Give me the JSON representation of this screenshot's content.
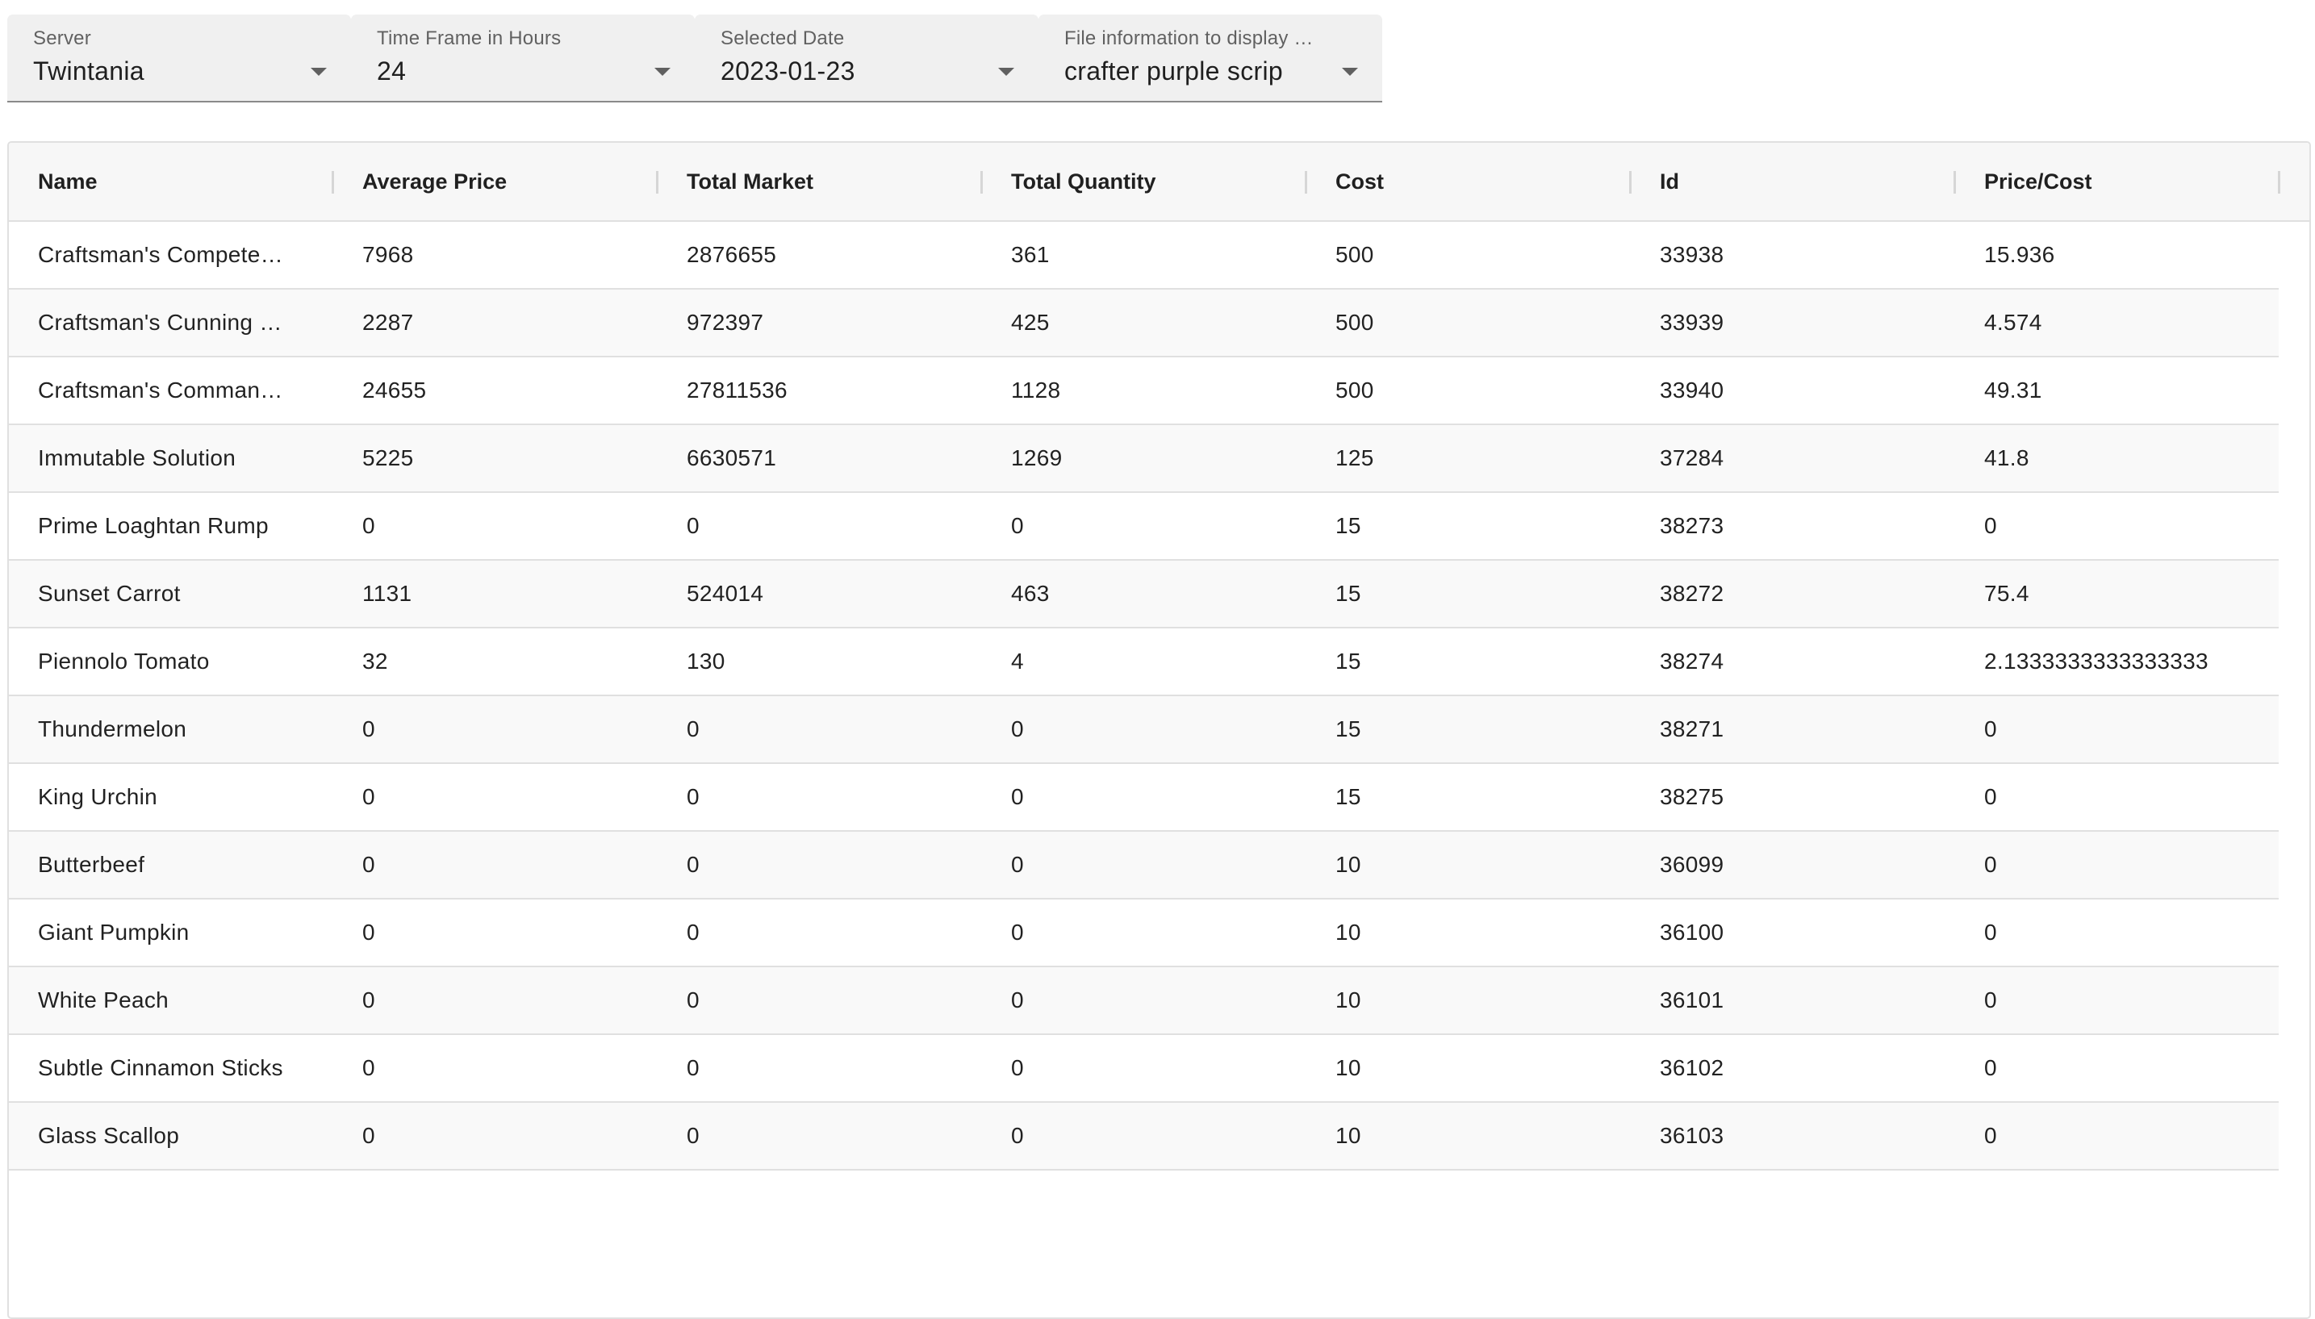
{
  "filters": [
    {
      "label": "Server",
      "value": "Twintania"
    },
    {
      "label": "Time Frame in Hours",
      "value": "24"
    },
    {
      "label": "Selected Date",
      "value": "2023-01-23"
    },
    {
      "label": "File information to display …",
      "value": "crafter purple scrip"
    }
  ],
  "table": {
    "columns": [
      "Name",
      "Average Price",
      "Total Market",
      "Total Quantity",
      "Cost",
      "Id",
      "Price/Cost"
    ],
    "rows": [
      [
        "Craftsman's Compete…",
        "7968",
        "2876655",
        "361",
        "500",
        "33938",
        "15.936"
      ],
      [
        "Craftsman's Cunning …",
        "2287",
        "972397",
        "425",
        "500",
        "33939",
        "4.574"
      ],
      [
        "Craftsman's Comman…",
        "24655",
        "27811536",
        "1128",
        "500",
        "33940",
        "49.31"
      ],
      [
        "Immutable Solution",
        "5225",
        "6630571",
        "1269",
        "125",
        "37284",
        "41.8"
      ],
      [
        "Prime Loaghtan Rump",
        "0",
        "0",
        "0",
        "15",
        "38273",
        "0"
      ],
      [
        "Sunset Carrot",
        "1131",
        "524014",
        "463",
        "15",
        "38272",
        "75.4"
      ],
      [
        "Piennolo Tomato",
        "32",
        "130",
        "4",
        "15",
        "38274",
        "2.1333333333333333"
      ],
      [
        "Thundermelon",
        "0",
        "0",
        "0",
        "15",
        "38271",
        "0"
      ],
      [
        "King Urchin",
        "0",
        "0",
        "0",
        "15",
        "38275",
        "0"
      ],
      [
        "Butterbeef",
        "0",
        "0",
        "0",
        "10",
        "36099",
        "0"
      ],
      [
        "Giant Pumpkin",
        "0",
        "0",
        "0",
        "10",
        "36100",
        "0"
      ],
      [
        "White Peach",
        "0",
        "0",
        "0",
        "10",
        "36101",
        "0"
      ],
      [
        "Subtle Cinnamon Sticks",
        "0",
        "0",
        "0",
        "10",
        "36102",
        "0"
      ],
      [
        "Glass Scallop",
        "0",
        "0",
        "0",
        "10",
        "36103",
        "0"
      ]
    ]
  }
}
